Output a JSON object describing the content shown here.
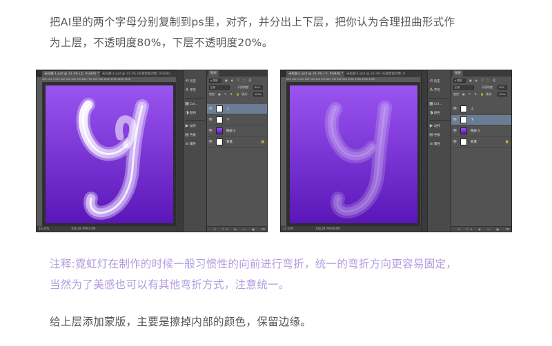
{
  "instructions": {
    "line1": "把AI里的两个字母分别复制到ps里，对齐，并分出上下层，把你认为合理扭曲形式作",
    "line2": "为上层，不透明度80%，下层不透明度20%。"
  },
  "note": {
    "line1": "注释:霓虹灯在制作的时候一般习惯性的向前进行弯折，统一的弯折方向更容易固定，",
    "line2": "当然为了美感也可以有其他弯折方式，注意统一。"
  },
  "footer_text": "给上层添加蒙版，主要是擦掉内部的颜色，保留边缘。",
  "screenshots": [
    {
      "doc_tab": "未标题-1.psd @ 33.3% (上, RGB/8) *",
      "other_tab": "未标题-1 psd @ 33.3% (矢量智能对象, RGB/8)",
      "ruler": "200 100 0 100 200 300 400 500 600 700 800 900 1000 1100 1200 1300",
      "zoom": "33.33%",
      "doc_size": "文档:29.7M/40.6M",
      "tool_icons": [
        "历史",
        "字符",
        "Col...",
        "颜色",
        "动作",
        "色板",
        "属性"
      ],
      "layers_tab": "图层",
      "kind_label": "正常",
      "opacity_label": "不透明度:",
      "opacity_value": "80%",
      "lock_label": "锁定:",
      "fill_label": "填充:",
      "fill_value": "100%",
      "layers": [
        {
          "name": "上",
          "selected": true
        },
        {
          "name": "下",
          "selected": false
        },
        {
          "name": "图层 4",
          "selected": false
        },
        {
          "name": "背景",
          "selected": false
        }
      ],
      "footer_icons": "ⓞ fx ◐ ▭ ▣ ⌫"
    },
    {
      "doc_tab": "未标题-1.psd @ 33.3% (下, RGB/8) *",
      "other_tab": "未标题-1 psd @ 33.3% (矢量智能对象, R",
      "ruler": "200 100 0 100 200 300 400 500 600 700 800 900 1000 1100 1200 1300",
      "zoom": "33.33%",
      "doc_size": "文档:29.7M/40.6M",
      "tool_icons": [
        "历史",
        "字符",
        "Col...",
        "颜色",
        "动作",
        "色板",
        "属性"
      ],
      "layers_tab": "图层",
      "kind_label": "正常",
      "opacity_label": "不透明度:",
      "opacity_value": "20%",
      "lock_label": "锁定:",
      "fill_label": "填充:",
      "fill_value": "100%",
      "layers": [
        {
          "name": "上",
          "selected": false
        },
        {
          "name": "下",
          "selected": true
        },
        {
          "name": "图层 4",
          "selected": false
        },
        {
          "name": "背景",
          "selected": false
        }
      ],
      "footer_icons": "ⓞ fx ◐ ▭ ▣ ⌫"
    }
  ],
  "colors": {
    "accent_note": "#b09be0",
    "artboard_top": "#9a55f0",
    "artboard_bottom": "#5a16b8",
    "selected_layer": "#6b7d94"
  }
}
